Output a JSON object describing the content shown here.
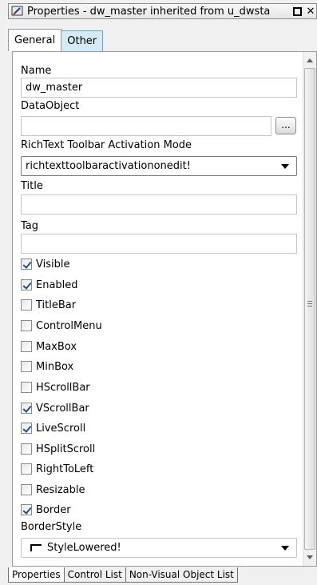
{
  "window": {
    "title": "Properties - dw_master inherited from u_dwsta"
  },
  "tabs_top": [
    {
      "label": "General",
      "active": true
    },
    {
      "label": "Other",
      "active": false
    }
  ],
  "fields": {
    "name_label": "Name",
    "name_value": "dw_master",
    "dataobject_label": "DataObject",
    "dataobject_value": "",
    "dataobject_button": "...",
    "richtext_label": "RichText Toolbar Activation Mode",
    "richtext_value": "richtexttoolbaractivationonedit!",
    "title_label": "Title",
    "title_value": "",
    "tag_label": "Tag",
    "tag_value": "",
    "borderstyle_label": "BorderStyle",
    "borderstyle_value": "StyleLowered!"
  },
  "checkboxes": [
    {
      "label": "Visible",
      "checked": true
    },
    {
      "label": "Enabled",
      "checked": true
    },
    {
      "label": "TitleBar",
      "checked": false
    },
    {
      "label": "ControlMenu",
      "checked": false
    },
    {
      "label": "MaxBox",
      "checked": false
    },
    {
      "label": "MinBox",
      "checked": false
    },
    {
      "label": "HScrollBar",
      "checked": false
    },
    {
      "label": "VScrollBar",
      "checked": true
    },
    {
      "label": "LiveScroll",
      "checked": true
    },
    {
      "label": "HSplitScroll",
      "checked": false
    },
    {
      "label": "RightToLeft",
      "checked": false
    },
    {
      "label": "Resizable",
      "checked": false
    },
    {
      "label": "Border",
      "checked": true
    }
  ],
  "tabs_bottom": [
    {
      "label": "Properties",
      "active": true
    },
    {
      "label": "Control List",
      "active": false
    },
    {
      "label": "Non-Visual Object List",
      "active": false
    }
  ],
  "icons": {
    "app": "properties-window-icon",
    "dropdown": "chevron-down-icon",
    "checkbox_checked": "checkmark-icon"
  },
  "colors": {
    "check": "#1e4f95",
    "tab_hover": "#d6eaf8"
  }
}
